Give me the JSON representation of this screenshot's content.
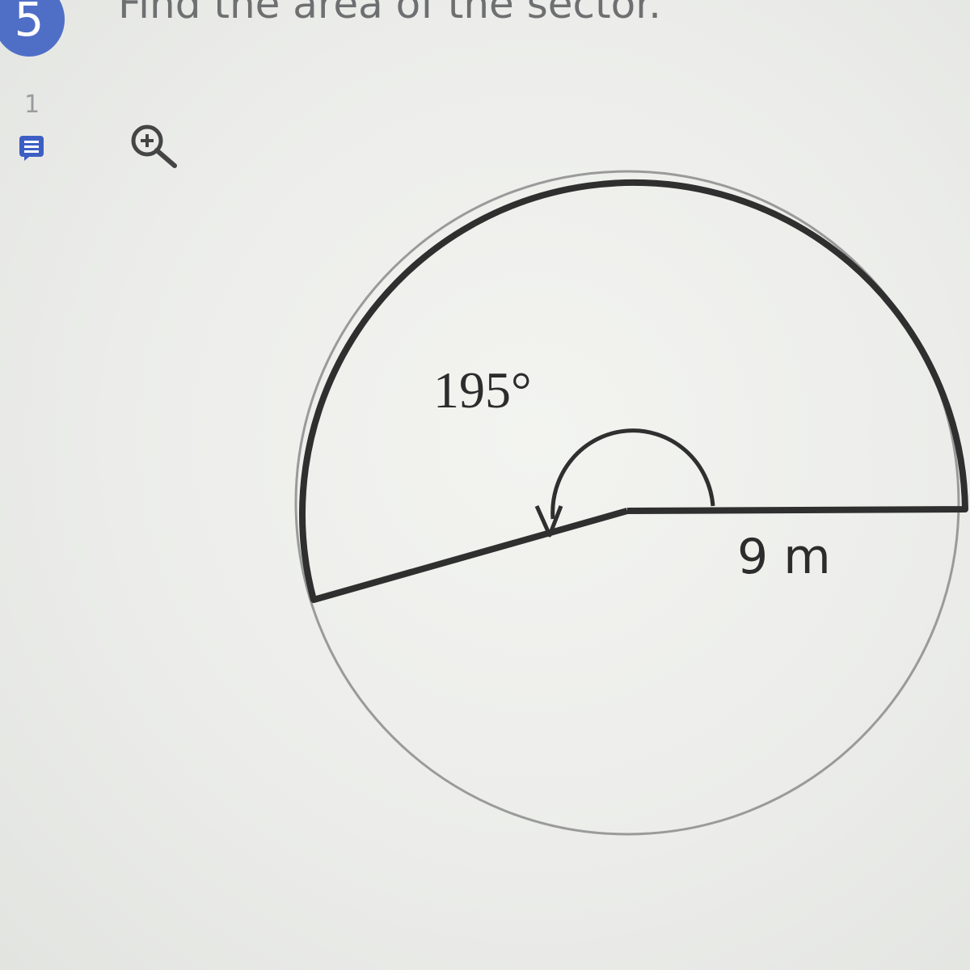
{
  "question": {
    "number": "5",
    "prompt": "Find the area of the sector.",
    "points": "1"
  },
  "toolbar": {
    "notes_icon": "notes-icon",
    "zoom_icon": "zoom-in-icon"
  },
  "figure": {
    "angle_label": "195°",
    "radius_label": "9 m",
    "angle_degrees": 195,
    "radius": 9
  },
  "colors": {
    "badge": "#4f6fc7",
    "prompt_text": "#6e6f71",
    "sector_outline": "#2f2f2f",
    "circle_outline": "#9a9a9a"
  }
}
